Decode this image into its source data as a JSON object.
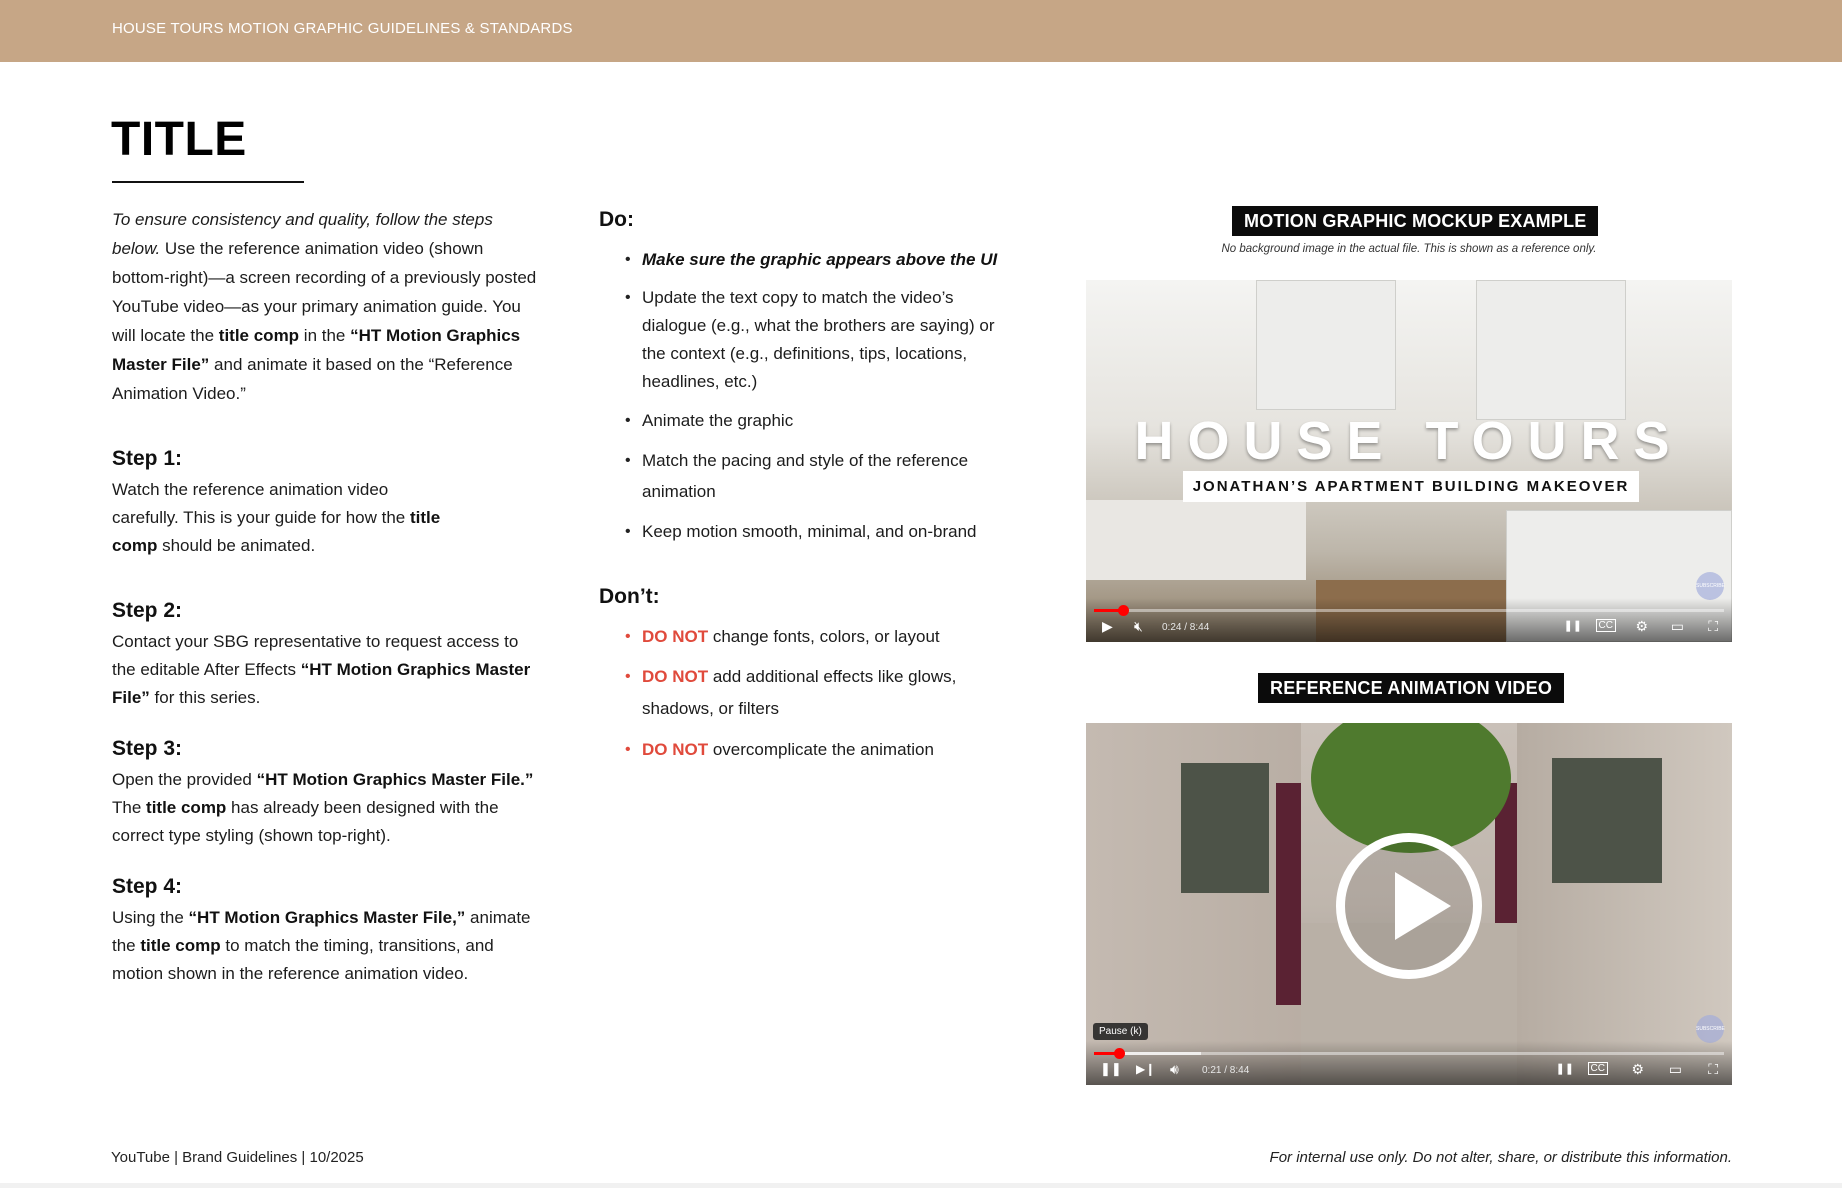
{
  "header": {
    "text": "HOUSE TOURS MOTION GRAPHIC GUIDELINES & STANDARDS"
  },
  "page": {
    "title": "TITLE"
  },
  "intro": {
    "italic": "To ensure consistency and quality, follow the steps below.",
    "p1": " Use the reference animation video (shown bottom-right)—a screen recording of a previously posted YouTube video—as your primary animation guide. You will locate the ",
    "b1": "title comp",
    "p2": " in the ",
    "b2": "“HT Motion Graphics Master File”",
    "p3": " and animate it based on the “Reference Animation Video.”"
  },
  "steps": [
    {
      "heading": "Step 1:",
      "t1": "Watch the reference animation video carefully. This is your guide for how the ",
      "b1": "title comp",
      "t2": " should be animated."
    },
    {
      "heading": "Step 2:",
      "t1": "Contact your SBG representative to request access to the editable After Effects ",
      "b1": "“HT Motion Graphics Master File”",
      "t2": " for this series."
    },
    {
      "heading": "Step 3:",
      "t1": "Open the provided ",
      "b1": "“HT Motion Graphics Master File.”",
      "t2": " The ",
      "b2": "title comp",
      "t3": " has already been designed with the correct type styling (shown top-right)."
    },
    {
      "heading": "Step 4:",
      "t1": "Using the ",
      "b1": "“HT Motion Graphics Master File,”",
      "t2": " animate the ",
      "b2": "title comp",
      "t3": " to match the timing, transitions, and motion shown in the reference animation video."
    }
  ],
  "do": {
    "heading": "Do:",
    "items": [
      "Make sure the graphic appears above the UI",
      "Update the text copy to match the video’s dialogue (e.g., what the brothers are saying) or the context (e.g., definitions, tips, locations, headlines, etc.)",
      "Animate the graphic",
      "Match the pacing and style of the reference animation",
      "Keep motion smooth, minimal, and on-brand"
    ]
  },
  "dont": {
    "heading": "Don’t:",
    "prefix": "DO NOT",
    "items": [
      " change fonts, colors, or layout",
      " add additional effects like glows, shadows, or filters",
      " overcomplicate the animation"
    ]
  },
  "mockup": {
    "label": "MOTION GRAPHIC MOCKUP EXAMPLE",
    "note": "No background image in the actual file. This is shown as a reference only.",
    "video_title": "HOUSE TOURS",
    "video_subtitle": "JONATHAN’S APARTMENT BUILDING MAKEOVER",
    "time": "0:24 / 8:44",
    "progress": 0.046,
    "subscribe": "SUBSCRIBE"
  },
  "reference": {
    "label": "REFERENCE ANIMATION VIDEO",
    "tooltip": "Pause (k)",
    "time": "0:21 / 8:44",
    "progress": 0.04,
    "buffered": 0.17,
    "subscribe": "SUBSCRIBE"
  },
  "footer": {
    "left": "YouTube | Brand Guidelines | 10/2025",
    "right": "For internal use only. Do not alter, share, or distribute this information."
  },
  "colors": {
    "header_bg": "#c6a686",
    "accent_red": "#e04a3c",
    "label_bg": "#0b0b0b"
  }
}
